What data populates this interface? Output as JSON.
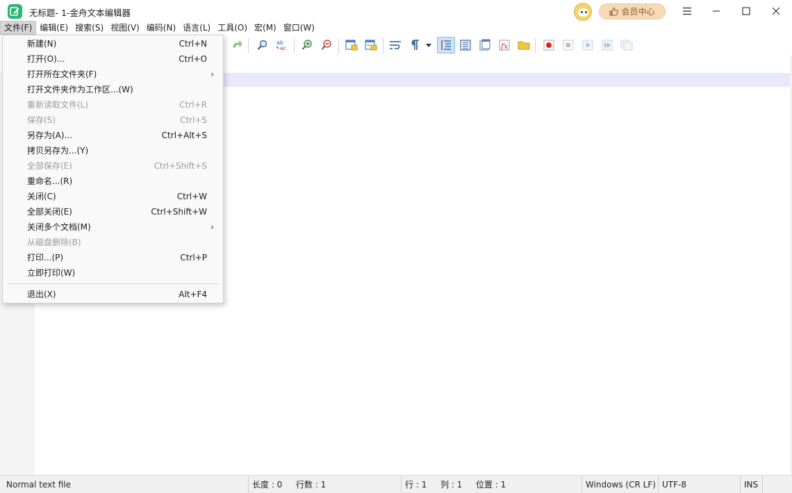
{
  "window": {
    "title": "无标题- 1-金舟文本编辑器",
    "vip_label": "会员中心",
    "controls": [
      "menu-icon",
      "minimize-icon",
      "maximize-icon",
      "close-icon"
    ]
  },
  "menubar": {
    "items": [
      "文件(F)",
      "编辑(E)",
      "搜索(S)",
      "视图(V)",
      "编码(N)",
      "语言(L)",
      "工具(O)",
      "宏(M)",
      "窗口(W)"
    ],
    "active_index": 0
  },
  "file_menu": {
    "items": [
      {
        "label": "新建(N)",
        "shortcut": "Ctrl+N",
        "enabled": true,
        "submenu": false
      },
      {
        "label": "打开(O)...",
        "shortcut": "Ctrl+O",
        "enabled": true,
        "submenu": false
      },
      {
        "label": "打开所在文件夹(F)",
        "shortcut": "",
        "enabled": true,
        "submenu": true
      },
      {
        "label": "打开文件夹作为工作区...(W)",
        "shortcut": "",
        "enabled": true,
        "submenu": false
      },
      {
        "label": "重新读取文件(L)",
        "shortcut": "Ctrl+R",
        "enabled": false,
        "submenu": false
      },
      {
        "label": "保存(S)",
        "shortcut": "Ctrl+S",
        "enabled": false,
        "submenu": false
      },
      {
        "label": "另存为(A)...",
        "shortcut": "Ctrl+Alt+S",
        "enabled": true,
        "submenu": false
      },
      {
        "label": "拷贝另存为...(Y)",
        "shortcut": "",
        "enabled": true,
        "submenu": false
      },
      {
        "label": "全部保存(E)",
        "shortcut": "Ctrl+Shift+S",
        "enabled": false,
        "submenu": false
      },
      {
        "label": "重命名...(R)",
        "shortcut": "",
        "enabled": true,
        "submenu": false
      },
      {
        "label": "关闭(C)",
        "shortcut": "Ctrl+W",
        "enabled": true,
        "submenu": false
      },
      {
        "label": "全部关闭(E)",
        "shortcut": "Ctrl+Shift+W",
        "enabled": true,
        "submenu": false
      },
      {
        "label": "关闭多个文档(M)",
        "shortcut": "",
        "enabled": true,
        "submenu": true
      },
      {
        "label": "从磁盘删除(B)",
        "shortcut": "",
        "enabled": false,
        "submenu": false
      },
      {
        "label": "打印...(P)",
        "shortcut": "Ctrl+P",
        "enabled": true,
        "submenu": false
      },
      {
        "label": "立即打印(W)",
        "shortcut": "",
        "enabled": true,
        "submenu": false
      }
    ],
    "exit": {
      "label": "退出(X)",
      "shortcut": "Alt+F4",
      "enabled": true
    },
    "submenu_arrow": "›"
  },
  "toolbar": {
    "icons": [
      "redo-icon",
      "find-icon",
      "replace-icon",
      "zoom-in-icon",
      "zoom-out-icon",
      "sync-vertical-icon",
      "sync-horizontal-icon",
      "word-wrap-icon",
      "show-all-chars-icon",
      "dropdown-arrow-icon",
      "indent-guide-icon",
      "document-map-icon",
      "document-list-icon",
      "function-list-icon",
      "folder-workspace-icon",
      "record-macro-icon",
      "stop-macro-icon",
      "play-macro-icon",
      "run-macro-multiple-icon",
      "save-macro-icon"
    ]
  },
  "statusbar": {
    "file_type": "Normal text file",
    "length": "长度 : 0",
    "lines": "行数 : 1",
    "row": "行 : 1",
    "col": "列 : 1",
    "pos": "位置 : 1",
    "eol": "Windows (CR LF)",
    "encoding": "UTF-8",
    "mode": "INS"
  },
  "colors": {
    "accent": "#2bb673",
    "current_line": "#e8e8fb",
    "selected_tool": "#cde3fb",
    "vip_bg": "#f6d9b6"
  }
}
